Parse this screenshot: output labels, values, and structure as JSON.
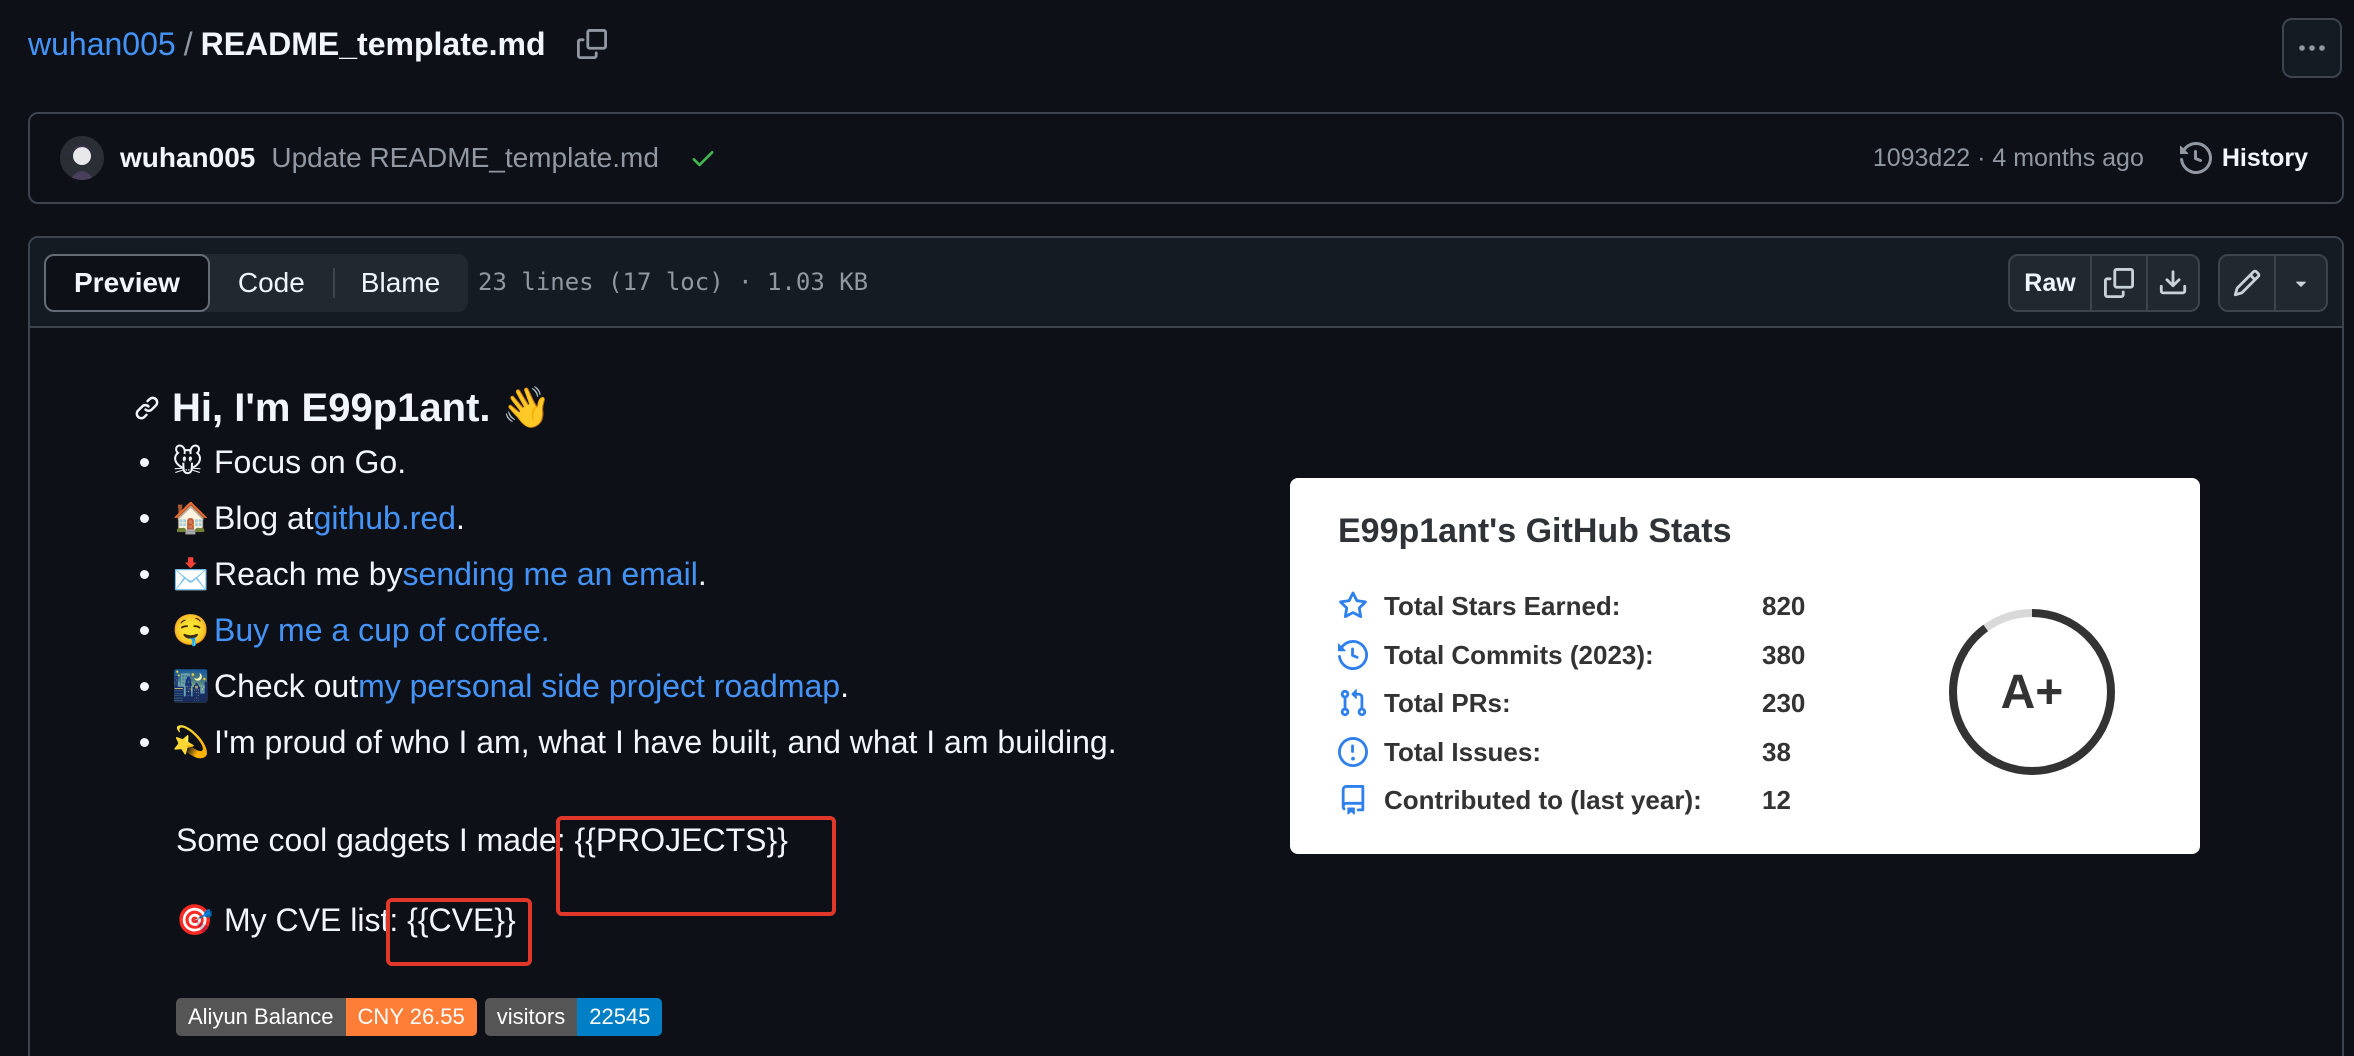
{
  "breadcrumb": {
    "owner": "wuhan005",
    "separator": "/",
    "file": "README_template.md"
  },
  "commit": {
    "author": "wuhan005",
    "message": "Update README_template.md",
    "meta": "1093d22 · 4 months ago",
    "history_label": "History"
  },
  "file_header": {
    "tabs": [
      "Preview",
      "Code",
      "Blame"
    ],
    "active_tab": "Preview",
    "info": "23 lines (17 loc) · 1.03 KB",
    "raw_label": "Raw"
  },
  "readme": {
    "heading": "Hi, I'm E99p1ant. 👋",
    "items": [
      {
        "emoji": "🐭",
        "pre": "Focus on Go.",
        "link": "",
        "post": ""
      },
      {
        "emoji": "🏠",
        "pre": "Blog at ",
        "link": "github.red",
        "post": "."
      },
      {
        "emoji": "📩",
        "pre": "Reach me by ",
        "link": "sending me an email",
        "post": "."
      },
      {
        "emoji": "🤤",
        "pre": "",
        "link": "Buy me a cup of coffee.",
        "post": ""
      },
      {
        "emoji": "🌃",
        "pre": "Check out ",
        "link": "my personal side project roadmap",
        "post": "."
      },
      {
        "emoji": "💫",
        "pre": "I'm proud of who I am, what I have built, and what I am building.",
        "link": "",
        "post": ""
      }
    ],
    "projects_line": "Some cool gadgets I made: {{PROJECTS}}",
    "cve_emoji": "🎯",
    "cve_line": "My CVE list: {{CVE}}",
    "badges": [
      {
        "label": "Aliyun Balance",
        "value": "CNY 26.55",
        "color": "#fe7d37"
      },
      {
        "label": "visitors",
        "value": "22545",
        "color": "#007ec6"
      }
    ]
  },
  "stats_card": {
    "title": "E99p1ant's GitHub Stats",
    "rows": [
      {
        "icon": "star-icon",
        "label": "Total Stars Earned:",
        "value": "820"
      },
      {
        "icon": "history-icon",
        "label": "Total Commits (2023):",
        "value": "380"
      },
      {
        "icon": "pull-request-icon",
        "label": "Total PRs:",
        "value": "230"
      },
      {
        "icon": "issue-icon",
        "label": "Total Issues:",
        "value": "38"
      },
      {
        "icon": "repo-icon",
        "label": "Contributed to (last year):",
        "value": "12"
      }
    ],
    "grade": "A+",
    "grade_progress": 0.9,
    "accent_color": "#2f80ed"
  },
  "colors": {
    "background": "#0d1117",
    "link": "#4493f8",
    "highlight_box": "#e0372a",
    "success": "#3fb950"
  }
}
